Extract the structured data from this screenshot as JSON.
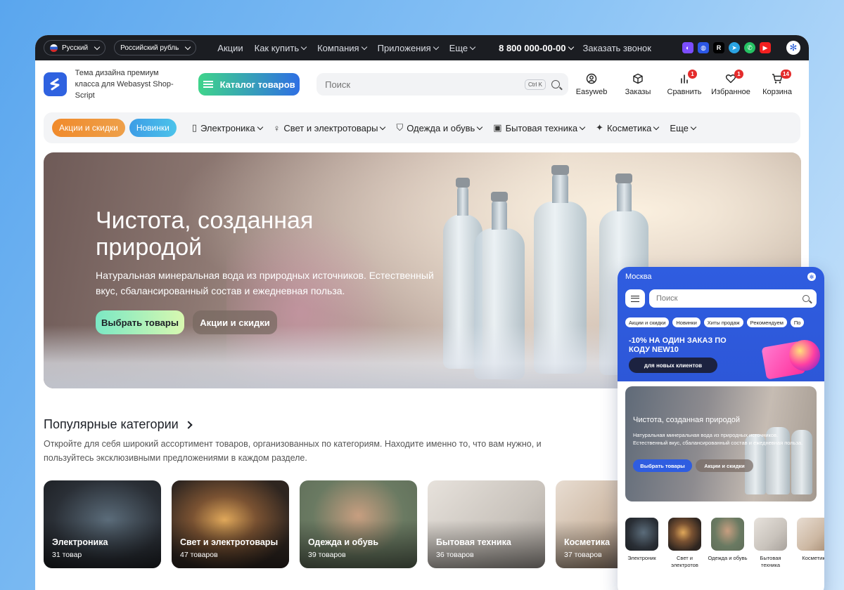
{
  "topbar": {
    "language": "Русский",
    "currency": "Российский рубль",
    "links": [
      "Акции",
      "Как купить",
      "Компания",
      "Приложения",
      "Еще"
    ],
    "phone": "8 800 000-00-00",
    "callback": "Заказать звонок"
  },
  "header": {
    "logo_text": "Тема дизайна премиум класса для Webasyst Shop-Script",
    "catalog_label": "Каталог товаров",
    "search_placeholder": "Поиск",
    "search_shortcut": "Ctrl K",
    "icons": [
      {
        "label": "Easyweb",
        "icon": "user-icon",
        "badge": ""
      },
      {
        "label": "Заказы",
        "icon": "box-icon",
        "badge": ""
      },
      {
        "label": "Сравнить",
        "icon": "compare-icon",
        "badge": "1"
      },
      {
        "label": "Избранное",
        "icon": "heart-icon",
        "badge": "1"
      },
      {
        "label": "Корзина",
        "icon": "cart-icon",
        "badge": "14"
      }
    ]
  },
  "nav": {
    "chip_sales": "Акции и скидки",
    "chip_new": "Новинки",
    "items": [
      "Электроника",
      "Свет и электротовары",
      "Одежда и обувь",
      "Бытовая техника",
      "Косметика",
      "Еще"
    ]
  },
  "hero": {
    "title": "Чистота, созданная природой",
    "subtitle": "Натуральная минеральная вода из природных источников. Естественный вкус, сбалансированный состав и ежедневная польза.",
    "primary_button": "Выбрать товары",
    "secondary_button": "Акции и скидки"
  },
  "categories": {
    "title": "Популярные категории",
    "description": "Откройте для себя широкий ассортимент товаров, организованных по категориям. Находите именно то, что вам нужно, и пользуйтесь эксклюзивными предложениями в каждом разделе.",
    "cards": [
      {
        "name": "Электроника",
        "count": "31 товар"
      },
      {
        "name": "Свет и электротовары",
        "count": "47 товаров"
      },
      {
        "name": "Одежда и обувь",
        "count": "39 товаров"
      },
      {
        "name": "Бытовая техника",
        "count": "36 товаров"
      },
      {
        "name": "Косметика",
        "count": "37 товаров"
      }
    ]
  },
  "mobile": {
    "city": "Москва",
    "search_placeholder": "Поиск",
    "chips": [
      "Акции и скидки",
      "Новинки",
      "Хиты продаж",
      "Рекомендуем",
      "По"
    ],
    "promo_text": "-10% НА ОДИН ЗАКАЗ ПО КОДУ NEW10",
    "promo_button": "для новых клиентов",
    "hero_title": "Чистота, созданная природой",
    "hero_subtitle": "Натуральная минеральная вода из природных источников. Естественный вкус, сбалансированный состав и ежедневная польза.",
    "hero_btn1": "Выбрать товары",
    "hero_btn2": "Акции и скидки",
    "cats": [
      "Электроник",
      "Свет и электротов",
      "Одежда и обувь",
      "Бытовая техника",
      "Косметик"
    ]
  },
  "colors": {
    "accent_blue": "#2f62e0",
    "badge_red": "#e42c2c",
    "topbar_dark": "#1b1d22"
  }
}
